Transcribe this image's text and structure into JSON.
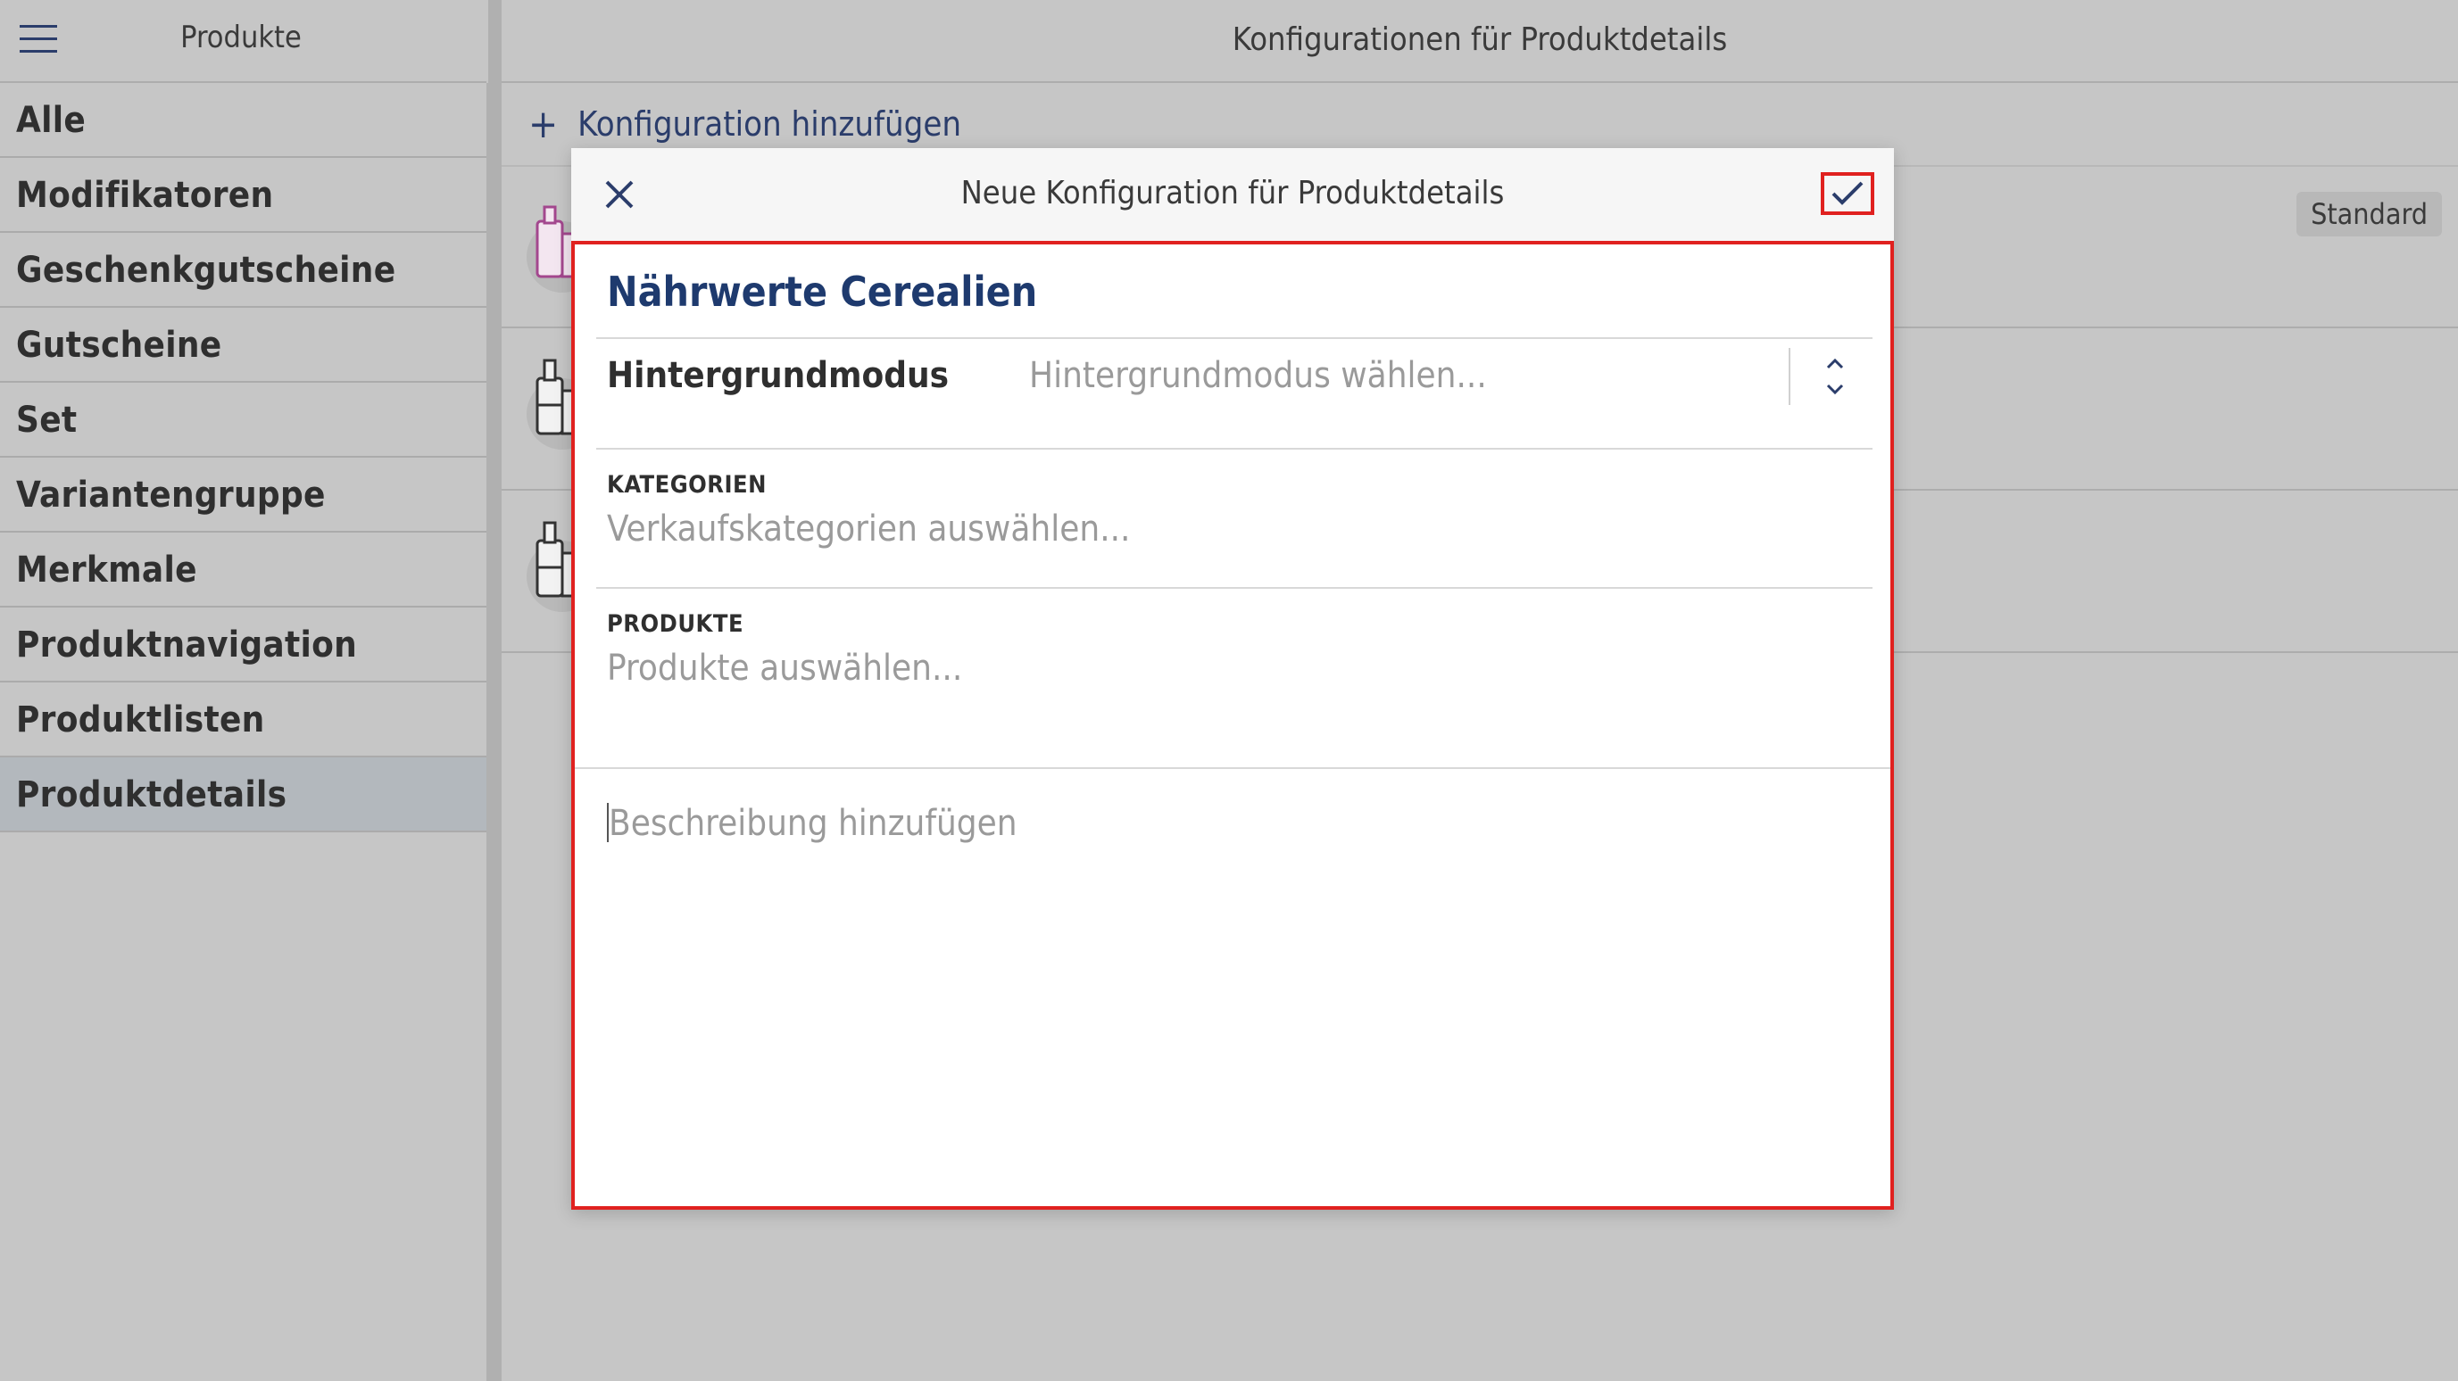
{
  "sidebar": {
    "title": "Produkte",
    "items": [
      {
        "label": "Alle"
      },
      {
        "label": "Modifikatoren"
      },
      {
        "label": "Geschenkgutscheine"
      },
      {
        "label": "Gutscheine"
      },
      {
        "label": "Set"
      },
      {
        "label": "Variantengruppe"
      },
      {
        "label": "Merkmale"
      },
      {
        "label": "Produktnavigation"
      },
      {
        "label": "Produktlisten"
      },
      {
        "label": "Produktdetails"
      }
    ],
    "active_index": 9
  },
  "main": {
    "title": "Konfigurationen für Produktdetails",
    "add_label": "Konfiguration hinzufügen",
    "badge": "Standard"
  },
  "modal": {
    "title": "Neue Konfiguration für Produktdetails",
    "name": "Nährwerte Cerealien",
    "background_mode_label": "Hintergrundmodus",
    "background_mode_placeholder": "Hintergrundmodus wählen...",
    "categories_label": "KATEGORIEN",
    "categories_placeholder": "Verkaufskategorien auswählen...",
    "products_label": "PRODUKTE",
    "products_placeholder": "Produkte auswählen...",
    "description_placeholder": "Beschreibung hinzufügen"
  },
  "colors": {
    "accent": "#1e3a6e",
    "highlight": "#e0211f",
    "background": "#c6c6c6"
  }
}
